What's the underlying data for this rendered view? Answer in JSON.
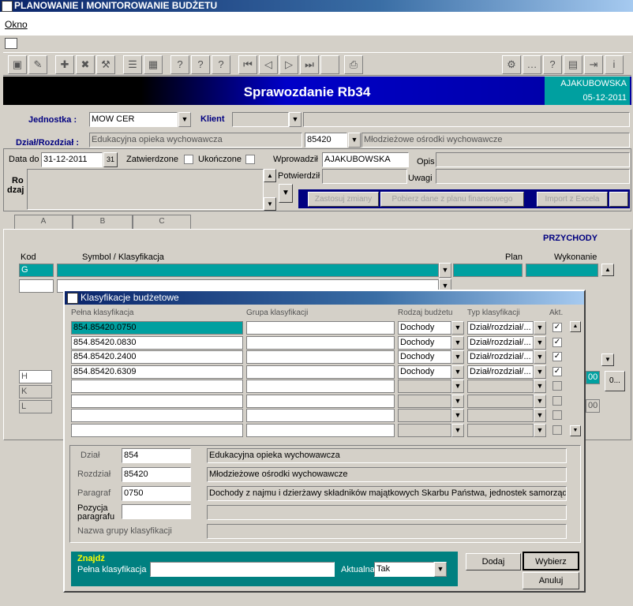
{
  "window": {
    "title": "PLANOWANIE I MONITOROWANIE BUDŻETU"
  },
  "menu": {
    "okno": "Okno"
  },
  "header": {
    "title": "Sprawozdanie Rb34",
    "user": "AJAKUBOWSKA",
    "date": "05-12-2011"
  },
  "form": {
    "jednostka_label": "Jednostka :",
    "jednostka_value": "MOW CER",
    "klient_label": "Klient",
    "klient_value": "",
    "dzial_label": "Dział/Rozdział :",
    "dzial_name": "Edukacyjna opieka wychowawcza",
    "rozdzial_code": "85420",
    "rozdzial_name": "Młodzieżowe ośrodki wychowawcze",
    "data_do_label": "Data do",
    "data_do_value": "31-12-2011",
    "zatwierdzone": "Zatwierdzone",
    "ukonczone": "Ukończone",
    "wprowadzil_label": "Wprowadził",
    "wprowadzil_value": "AJAKUBOWSKA",
    "potwierdzil_label": "Potwierdził",
    "opis_label": "Opis",
    "uwagi_label": "Uwagi",
    "rodzaj_label_1": "Ro",
    "rodzaj_label_2": "dzaj",
    "btn_zastosuj": "Zastosuj zmiany",
    "btn_pobierz": "Pobierz dane z planu finansowego",
    "btn_import": "Import z Excela"
  },
  "tabs": [
    "A",
    "B",
    "C"
  ],
  "main_grid": {
    "section": "PRZYCHODY",
    "kod": "Kod",
    "symbol": "Symbol / Klasyfikacja",
    "plan": "Plan",
    "wykonanie": "Wykonanie",
    "row_codes": [
      "G",
      "H",
      "K",
      "L"
    ],
    "amount_suffix": "00",
    "more_btn": "0..."
  },
  "dialog": {
    "title": "Klasyfikacje budżetowe",
    "columns": {
      "pelna": "Pełna klasyfikacja",
      "grupa": "Grupa klasyfikacji",
      "rodzaj": "Rodzaj budżetu",
      "typ": "Typ klasyfikacji",
      "akt": "Akt."
    },
    "rows": [
      {
        "pelna": "854.85420.0750",
        "grupa": "",
        "rodzaj": "Dochody",
        "typ": "Dział/rozdział/...",
        "akt": true
      },
      {
        "pelna": "854.85420.0830",
        "grupa": "",
        "rodzaj": "Dochody",
        "typ": "Dział/rozdział/...",
        "akt": true
      },
      {
        "pelna": "854.85420.2400",
        "grupa": "",
        "rodzaj": "Dochody",
        "typ": "Dział/rozdział/...",
        "akt": true
      },
      {
        "pelna": "854.85420.6309",
        "grupa": "",
        "rodzaj": "Dochody",
        "typ": "Dział/rozdział/...",
        "akt": true
      }
    ],
    "detail": {
      "dzial_label": "Dział",
      "dzial_value": "854",
      "dzial_name": "Edukacyjna opieka wychowawcza",
      "rozdzial_label": "Rozdział",
      "rozdzial_value": "85420",
      "rozdzial_name": "Młodzieżowe ośrodki wychowawcze",
      "paragraf_label": "Paragraf",
      "paragraf_value": "0750",
      "paragraf_name": "Dochody z najmu i dzierżawy składników majątkowych Skarbu Państwa, jednostek samorząd",
      "pozycja_label_1": "Pozycja",
      "pozycja_label_2": "paragrafu",
      "nazwa_grupy_label": "Nazwa grupy klasyfikacji"
    },
    "find": {
      "title": "Znajdź",
      "pelna_label": "Pełna klasyfikacja",
      "pelna_value": "",
      "aktualna_label": "Aktualna",
      "aktualna_value": "Tak"
    },
    "buttons": {
      "dodaj": "Dodaj",
      "wybierz": "Wybierz",
      "anuluj": "Anuluj"
    }
  }
}
